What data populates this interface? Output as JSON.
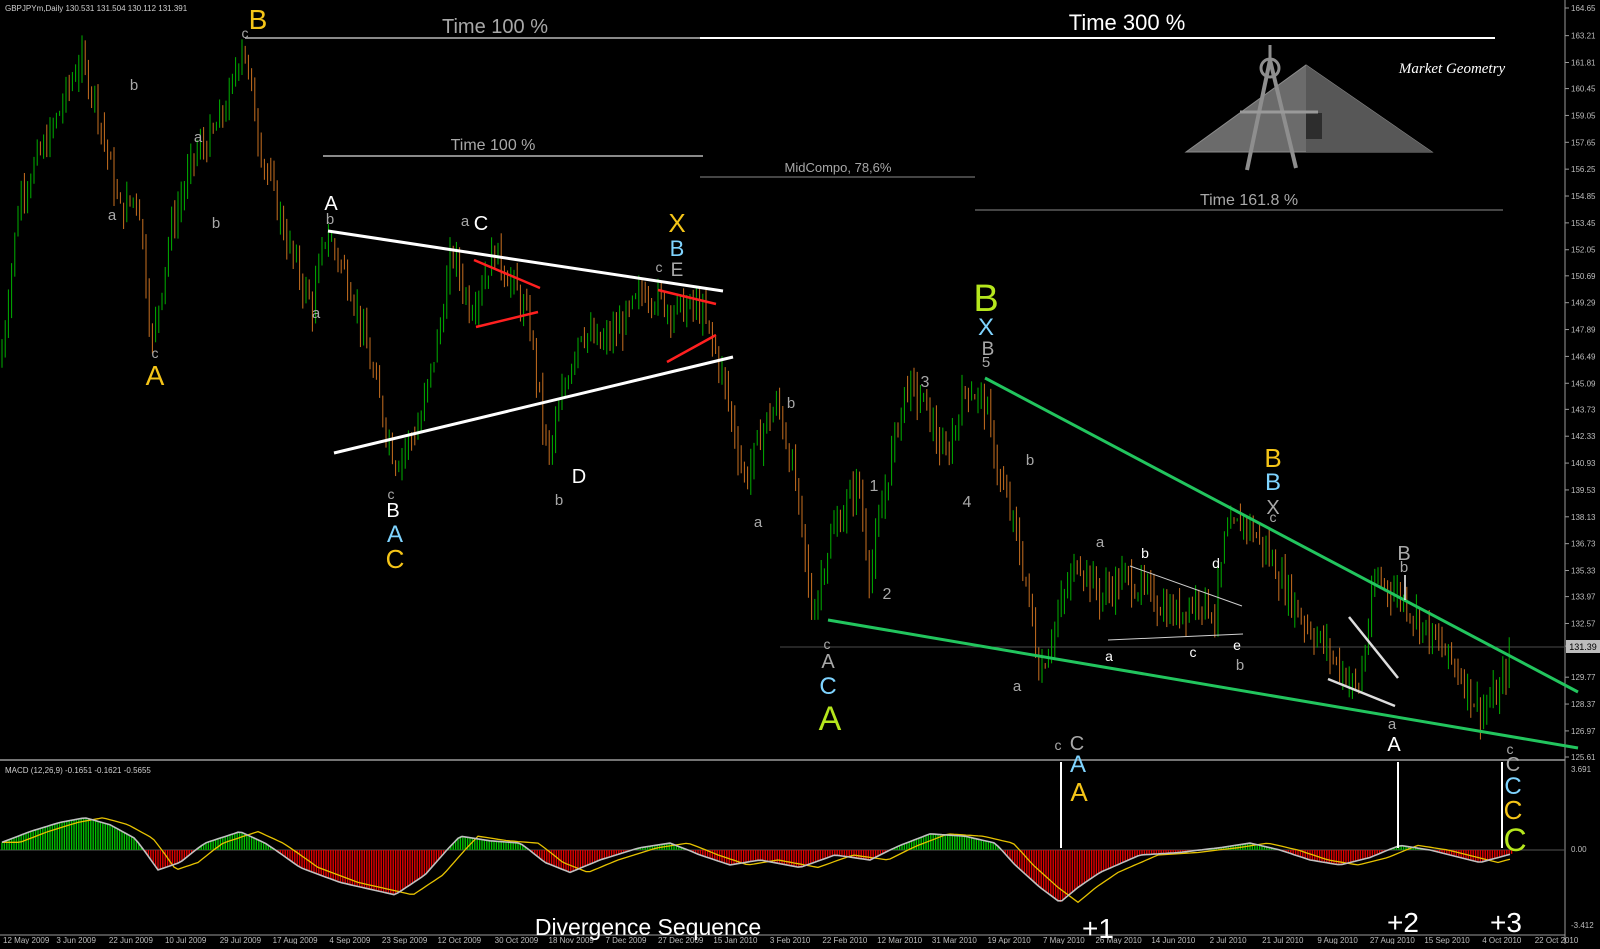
{
  "window_title": "GBPJPYm,Daily  130.531 131.504 130.112 131.391",
  "macd_title": "MACD (12,26,9) -0.1651 -0.1621 -0.5655",
  "logo_text": "Market Geometry",
  "current_price_label": "131.39",
  "footer_text": "Divergence Sequence",
  "colors": {
    "up_candle": "#00b000",
    "down_candle": "#c87020",
    "hist_pos": "#00c000",
    "hist_neg": "#e00000",
    "macd_line": "#c0c0c0",
    "signal_line": "#e6c200",
    "yellow": "#f5c518",
    "light_blue": "#7fd4ff",
    "lime": "#b5e61d",
    "grey": "#a8a8a8",
    "white": "#ffffff",
    "green_line": "#22c55e",
    "red_line": "#ff2020"
  },
  "chart_data": {
    "type": "candlestick",
    "symbol": "GBPJPYm",
    "timeframe": "Daily",
    "ohlc": {
      "open": 130.531,
      "high": 131.504,
      "low": 130.112,
      "close": 131.391
    },
    "ylim": [
      125.61,
      164.65
    ],
    "y_ticks": [
      "164.65",
      "163.21",
      "161.81",
      "160.45",
      "159.05",
      "157.65",
      "156.25",
      "154.85",
      "153.45",
      "152.05",
      "150.69",
      "149.29",
      "147.89",
      "146.49",
      "145.09",
      "143.73",
      "142.33",
      "140.93",
      "139.53",
      "138.13",
      "136.73",
      "135.33",
      "133.97",
      "132.57",
      "131.39",
      "129.77",
      "128.37",
      "126.97",
      "125.61"
    ],
    "x_ticks": [
      "12 May 2009",
      "3 Jun 2009",
      "22 Jun 2009",
      "10 Jul 2009",
      "29 Jul 2009",
      "17 Aug 2009",
      "4 Sep 2009",
      "23 Sep 2009",
      "12 Oct 2009",
      "30 Oct 2009",
      "18 Nov 2009",
      "7 Dec 2009",
      "27 Dec 2009",
      "15 Jan 2010",
      "3 Feb 2010",
      "22 Feb 2010",
      "12 Mar 2010",
      "31 Mar 2010",
      "19 Apr 2010",
      "7 May 2010",
      "26 May 2010",
      "14 Jun 2010",
      "2 Jul 2010",
      "21 Jul 2010",
      "9 Aug 2010",
      "27 Aug 2010",
      "15 Sep 2010",
      "4 Oct 2010",
      "22 Oct 2010"
    ],
    "price_path": [
      [
        0,
        146
      ],
      [
        20,
        155
      ],
      [
        50,
        158
      ],
      [
        80,
        162
      ],
      [
        95,
        160
      ],
      [
        120,
        154
      ],
      [
        138,
        155
      ],
      [
        152,
        147
      ],
      [
        170,
        153
      ],
      [
        195,
        157
      ],
      [
        213,
        158
      ],
      [
        230,
        160
      ],
      [
        242,
        163
      ],
      [
        262,
        157
      ],
      [
        290,
        152
      ],
      [
        312,
        149
      ],
      [
        326,
        153
      ],
      [
        352,
        150
      ],
      [
        380,
        144
      ],
      [
        395,
        141
      ],
      [
        420,
        143
      ],
      [
        440,
        148
      ],
      [
        452,
        152
      ],
      [
        470,
        149
      ],
      [
        495,
        152
      ],
      [
        515,
        150
      ],
      [
        530,
        148
      ],
      [
        548,
        141
      ],
      [
        565,
        145
      ],
      [
        580,
        148
      ],
      [
        600,
        147
      ],
      [
        620,
        148
      ],
      [
        645,
        150
      ],
      [
        670,
        149
      ],
      [
        700,
        149
      ],
      [
        720,
        146
      ],
      [
        745,
        140
      ],
      [
        765,
        143
      ],
      [
        778,
        144
      ],
      [
        795,
        140
      ],
      [
        812,
        133
      ],
      [
        830,
        137
      ],
      [
        858,
        140
      ],
      [
        870,
        135
      ],
      [
        890,
        141
      ],
      [
        906,
        145
      ],
      [
        925,
        144
      ],
      [
        945,
        141
      ],
      [
        966,
        145
      ],
      [
        985,
        144
      ],
      [
        1000,
        140
      ],
      [
        1012,
        138
      ],
      [
        1025,
        135
      ],
      [
        1040,
        130
      ],
      [
        1058,
        133
      ],
      [
        1078,
        136
      ],
      [
        1100,
        134
      ],
      [
        1125,
        135
      ],
      [
        1150,
        134
      ],
      [
        1175,
        133
      ],
      [
        1200,
        134
      ],
      [
        1215,
        133
      ],
      [
        1225,
        137
      ],
      [
        1245,
        138
      ],
      [
        1270,
        136
      ],
      [
        1300,
        133
      ],
      [
        1330,
        131
      ],
      [
        1358,
        129
      ],
      [
        1376,
        135
      ],
      [
        1400,
        134
      ],
      [
        1430,
        132
      ],
      [
        1460,
        130
      ],
      [
        1480,
        128
      ],
      [
        1500,
        129
      ],
      [
        1512,
        131.4
      ]
    ],
    "macd_path": [
      [
        0,
        0.3
      ],
      [
        30,
        0.8
      ],
      [
        60,
        1.2
      ],
      [
        85,
        1.4
      ],
      [
        110,
        1.1
      ],
      [
        135,
        0.5
      ],
      [
        158,
        -0.8
      ],
      [
        180,
        -0.5
      ],
      [
        205,
        0.3
      ],
      [
        240,
        0.8
      ],
      [
        265,
        0.3
      ],
      [
        300,
        -0.7
      ],
      [
        340,
        -1.3
      ],
      [
        395,
        -1.8
      ],
      [
        425,
        -1.0
      ],
      [
        460,
        0.6
      ],
      [
        490,
        0.4
      ],
      [
        520,
        0.3
      ],
      [
        545,
        -0.5
      ],
      [
        570,
        -0.9
      ],
      [
        600,
        -0.4
      ],
      [
        640,
        0.1
      ],
      [
        670,
        0.3
      ],
      [
        700,
        -0.2
      ],
      [
        730,
        -0.6
      ],
      [
        760,
        -0.4
      ],
      [
        800,
        -0.7
      ],
      [
        835,
        -0.2
      ],
      [
        870,
        -0.4
      ],
      [
        900,
        0.2
      ],
      [
        930,
        0.7
      ],
      [
        965,
        0.6
      ],
      [
        995,
        0.3
      ],
      [
        1015,
        -0.6
      ],
      [
        1040,
        -1.5
      ],
      [
        1060,
        -2.1
      ],
      [
        1078,
        -1.5
      ],
      [
        1100,
        -0.9
      ],
      [
        1140,
        -0.2
      ],
      [
        1180,
        -0.1
      ],
      [
        1220,
        0.1
      ],
      [
        1250,
        0.3
      ],
      [
        1280,
        0.0
      ],
      [
        1310,
        -0.4
      ],
      [
        1340,
        -0.6
      ],
      [
        1370,
        -0.3
      ],
      [
        1400,
        0.2
      ],
      [
        1430,
        0.0
      ],
      [
        1460,
        -0.3
      ],
      [
        1480,
        -0.5
      ],
      [
        1512,
        -0.15
      ]
    ],
    "macd_ylim": [
      -3.412,
      3.691
    ],
    "macd_y_ticks": [
      "3.691",
      "0.00",
      "-3.412"
    ]
  },
  "annotations": {
    "time_labels": [
      {
        "text": "Time 100 %",
        "color": "grey",
        "size": 20
      },
      {
        "text": "Time 300 %",
        "color": "white",
        "size": 22
      },
      {
        "text": "Time 100 %",
        "color": "grey",
        "size": 16
      },
      {
        "text": "MidCompo, 78,6%",
        "color": "grey",
        "size": 13
      },
      {
        "text": "Time 161.8 %",
        "color": "grey",
        "size": 16
      }
    ],
    "wave_labels": [
      {
        "text": "B",
        "color": "yellow",
        "size": 28
      },
      {
        "text": "c",
        "color": "grey",
        "size": 14
      },
      {
        "text": "b",
        "color": "grey",
        "size": 15
      },
      {
        "text": "a",
        "color": "grey",
        "size": 15
      },
      {
        "text": "a",
        "color": "grey",
        "size": 15
      },
      {
        "text": "b",
        "color": "grey",
        "size": 15
      },
      {
        "text": "c",
        "color": "grey",
        "size": 14
      },
      {
        "text": "A",
        "color": "yellow",
        "size": 28
      },
      {
        "text": "A",
        "color": "white",
        "size": 20
      },
      {
        "text": "b",
        "color": "grey",
        "size": 15
      },
      {
        "text": "a",
        "color": "grey",
        "size": 15
      },
      {
        "text": "a",
        "color": "grey",
        "size": 15
      },
      {
        "text": "C",
        "color": "white",
        "size": 20
      },
      {
        "text": "c",
        "color": "grey",
        "size": 14
      },
      {
        "text": "B",
        "color": "white",
        "size": 20
      },
      {
        "text": "A",
        "color": "light_blue",
        "size": 24
      },
      {
        "text": "C",
        "color": "yellow",
        "size": 26
      },
      {
        "text": "D",
        "color": "white",
        "size": 20
      },
      {
        "text": "b",
        "color": "grey",
        "size": 15
      },
      {
        "text": "X",
        "color": "yellow",
        "size": 26
      },
      {
        "text": "B",
        "color": "light_blue",
        "size": 22
      },
      {
        "text": "E",
        "color": "grey",
        "size": 19
      },
      {
        "text": "c",
        "color": "grey",
        "size": 14
      },
      {
        "text": "b",
        "color": "grey",
        "size": 15
      },
      {
        "text": "a",
        "color": "grey",
        "size": 15
      },
      {
        "text": "c",
        "color": "grey",
        "size": 14
      },
      {
        "text": "A",
        "color": "grey",
        "size": 20
      },
      {
        "text": "C",
        "color": "light_blue",
        "size": 24
      },
      {
        "text": "A",
        "color": "lime",
        "size": 34
      },
      {
        "text": "1",
        "color": "grey",
        "size": 16
      },
      {
        "text": "2",
        "color": "grey",
        "size": 16
      },
      {
        "text": "3",
        "color": "grey",
        "size": 16
      },
      {
        "text": "4",
        "color": "grey",
        "size": 16
      },
      {
        "text": "B",
        "color": "lime",
        "size": 38
      },
      {
        "text": "X",
        "color": "light_blue",
        "size": 24
      },
      {
        "text": "B",
        "color": "grey",
        "size": 19
      },
      {
        "text": "5",
        "color": "grey",
        "size": 15
      },
      {
        "text": "b",
        "color": "grey",
        "size": 15
      },
      {
        "text": "a",
        "color": "grey",
        "size": 15
      },
      {
        "text": "a",
        "color": "grey",
        "size": 15
      },
      {
        "text": "c",
        "color": "grey",
        "size": 14
      },
      {
        "text": "C",
        "color": "grey",
        "size": 20
      },
      {
        "text": "A",
        "color": "light_blue",
        "size": 24
      },
      {
        "text": "A",
        "color": "yellow",
        "size": 26
      },
      {
        "text": "a",
        "color": "white",
        "size": 14
      },
      {
        "text": "b",
        "color": "white",
        "size": 14
      },
      {
        "text": "c",
        "color": "white",
        "size": 14
      },
      {
        "text": "d",
        "color": "white",
        "size": 14
      },
      {
        "text": "e",
        "color": "white",
        "size": 14
      },
      {
        "text": "b",
        "color": "grey",
        "size": 15
      },
      {
        "text": "B",
        "color": "yellow",
        "size": 26
      },
      {
        "text": "B",
        "color": "light_blue",
        "size": 24
      },
      {
        "text": "X",
        "color": "grey",
        "size": 20
      },
      {
        "text": "c",
        "color": "grey",
        "size": 14
      },
      {
        "text": "B",
        "color": "grey",
        "size": 20
      },
      {
        "text": "b",
        "color": "grey",
        "size": 15
      },
      {
        "text": "a",
        "color": "grey",
        "size": 15
      },
      {
        "text": "A",
        "color": "white",
        "size": 20
      },
      {
        "text": "c",
        "color": "grey",
        "size": 14
      },
      {
        "text": "C",
        "color": "grey",
        "size": 20
      },
      {
        "text": "C",
        "color": "light_blue",
        "size": 24
      },
      {
        "text": "C",
        "color": "yellow",
        "size": 26
      },
      {
        "text": "C",
        "color": "lime",
        "size": 32
      }
    ],
    "divergence_labels": [
      "+1",
      "+2",
      "+3"
    ]
  }
}
